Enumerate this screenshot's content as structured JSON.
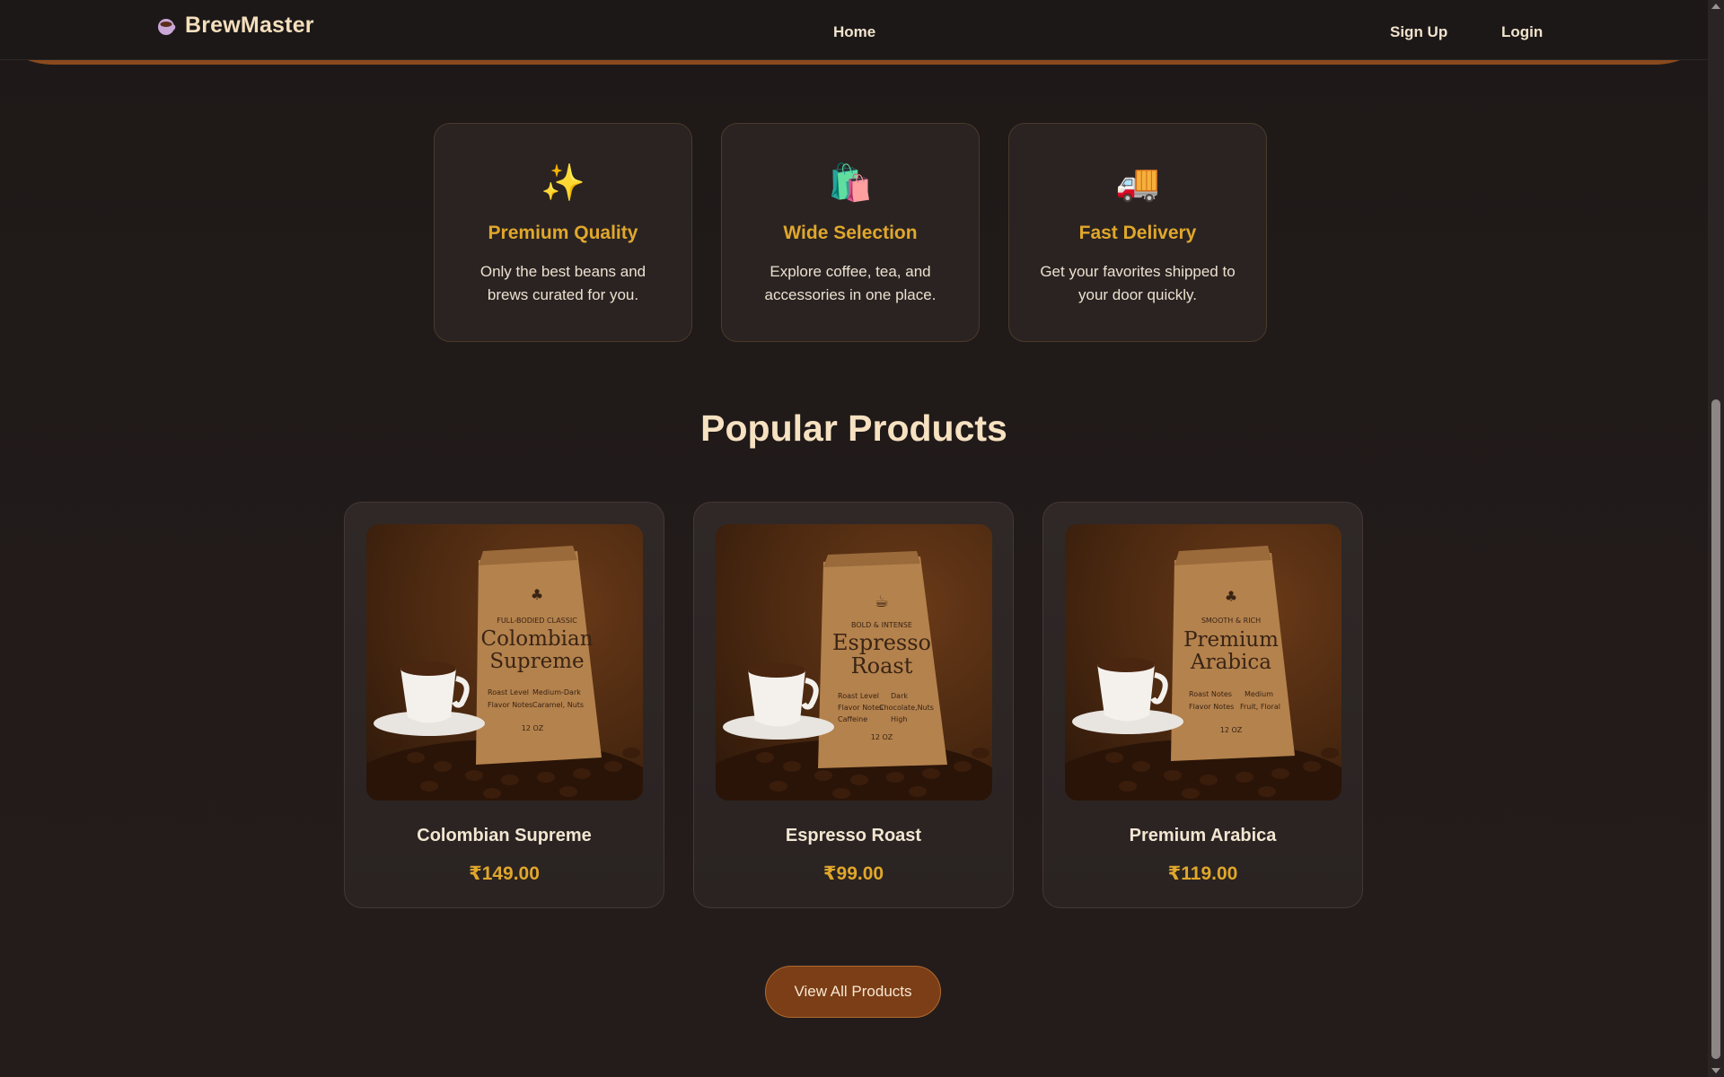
{
  "navbar": {
    "brand": "BrewMaster",
    "brand_icon": "coffee-cup-icon",
    "links": {
      "home": "Home",
      "signup": "Sign Up",
      "login": "Login"
    }
  },
  "features": [
    {
      "icon": "sparkles-icon",
      "glyph": "✨",
      "title": "Premium Quality",
      "text": "Only the best beans and brews curated for you."
    },
    {
      "icon": "shopping-bags-icon",
      "glyph": "🛍️",
      "title": "Wide Selection",
      "text": "Explore coffee, tea, and accessories in one place."
    },
    {
      "icon": "delivery-truck-icon",
      "glyph": "🚚",
      "title": "Fast Delivery",
      "text": "Get your favorites shipped to your door quickly."
    }
  ],
  "popular": {
    "title": "Popular Products",
    "products": [
      {
        "name": "Colombian Supreme",
        "price": "₹149.00",
        "bag": {
          "tag": "FULL-BODIED CLASSIC",
          "line1": "Colombian",
          "line2": "Supreme",
          "r1a": "Roast Level",
          "r1b": "Medium-Dark",
          "r2a": "Flavor Notes",
          "r2b": "Caramel, Nuts",
          "weight": "12 OZ"
        }
      },
      {
        "name": "Espresso Roast",
        "price": "₹99.00",
        "bag": {
          "tag": "BOLD & INTENSE",
          "line1": "Espresso",
          "line2": "Roast",
          "r1a": "Roast Level",
          "r1b": "Dark",
          "r2a": "Flavor Notes",
          "r2b": "Chocolate,Nuts",
          "r3a": "Caffeine",
          "r3b": "High",
          "weight": "12 OZ"
        }
      },
      {
        "name": "Premium Arabica",
        "price": "₹119.00",
        "bag": {
          "tag": "SMOOTH & RICH",
          "line1": "Premium",
          "line2": "Arabica",
          "r1a": "Roast Notes",
          "r1b": "Medium",
          "r2a": "Flavor Notes",
          "r2b": "Fruit, Floral",
          "weight": "12 OZ"
        }
      }
    ],
    "cta": "View All Products"
  },
  "colors": {
    "accent": "#e0a72b",
    "background": "#1f1a19",
    "button": "#7b3e16",
    "hero_band": "#8a4a1e"
  }
}
